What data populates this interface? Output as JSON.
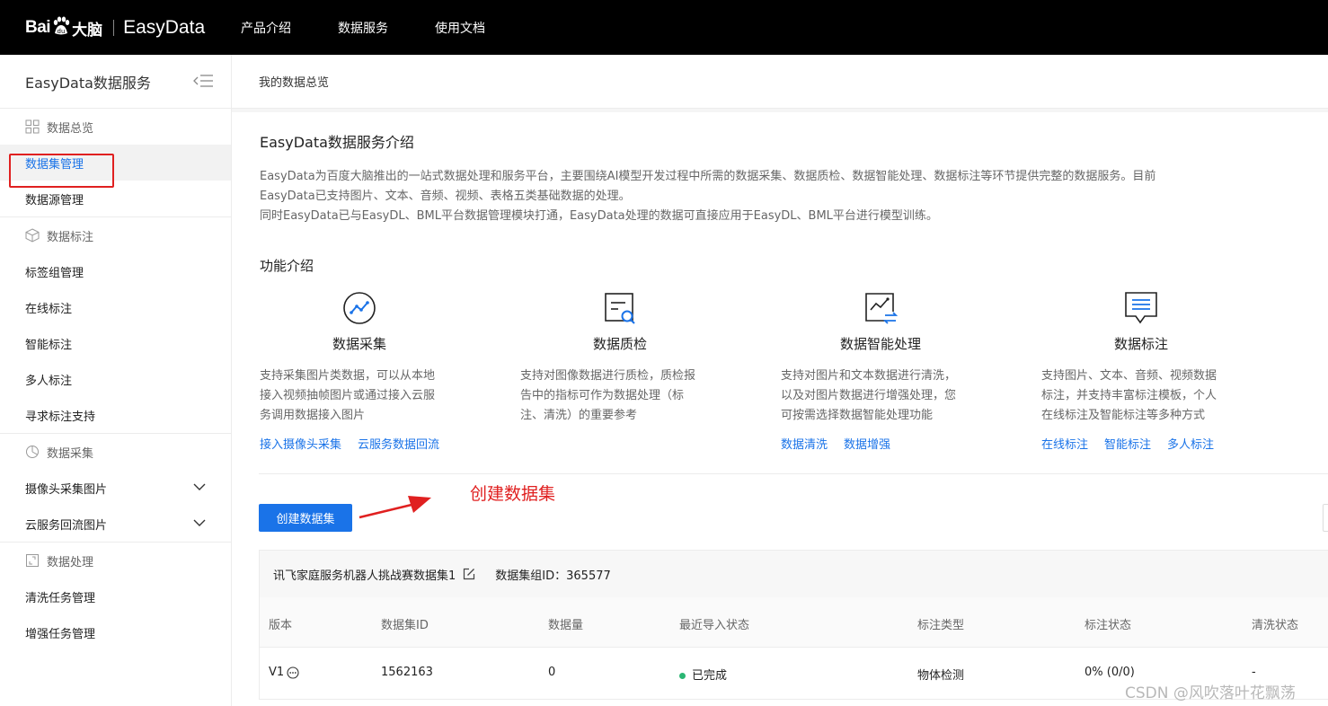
{
  "topbar": {
    "logo_bai": "Bai",
    "logo_danao": "大脑",
    "logo_product": "EasyData",
    "nav": [
      "产品介绍",
      "数据服务",
      "使用文档"
    ]
  },
  "sidebar": {
    "title": "EasyData数据服务",
    "groups": [
      {
        "label": "数据总览",
        "icon": "grid-icon",
        "items": [
          {
            "label": "数据集管理",
            "active": true
          },
          {
            "label": "数据源管理"
          }
        ]
      },
      {
        "label": "数据标注",
        "icon": "cube-icon",
        "items": [
          {
            "label": "标签组管理"
          },
          {
            "label": "在线标注"
          },
          {
            "label": "智能标注"
          },
          {
            "label": "多人标注"
          },
          {
            "label": "寻求标注支持"
          }
        ]
      },
      {
        "label": "数据采集",
        "icon": "pie-icon",
        "items": [
          {
            "label": "摄像头采集图片",
            "expandable": true
          },
          {
            "label": "云服务回流图片",
            "expandable": true
          }
        ]
      },
      {
        "label": "数据处理",
        "icon": "process-icon",
        "items": [
          {
            "label": "清洗任务管理"
          },
          {
            "label": "增强任务管理"
          }
        ]
      }
    ]
  },
  "main": {
    "breadcrumb": "我的数据总览",
    "intro_title": "EasyData数据服务介绍",
    "intro_lines": [
      "EasyData为百度大脑推出的一站式数据处理和服务平台，主要围绕AI模型开发过程中所需的数据采集、数据质检、数据智能处理、数据标注等环节提供完整的数据服务。目前",
      "EasyData已支持图片、文本、音频、视频、表格五类基础数据的处理。",
      "同时EasyData已与EasyDL、BML平台数据管理模块打通，EasyData处理的数据可直接应用于EasyDL、BML平台进行模型训练。"
    ],
    "features_title": "功能介绍",
    "features": [
      {
        "name": "数据采集",
        "icon": "collect-icon",
        "lines": [
          "支持采集图片类数据，可以从本地",
          "接入视频抽帧图片或通过接入云服",
          "务调用数据接入图片"
        ],
        "links": [
          "接入摄像头采集",
          "云服务数据回流"
        ]
      },
      {
        "name": "数据质检",
        "icon": "inspect-icon",
        "lines": [
          "支持对图像数据进行质检，质检报",
          "告中的指标可作为数据处理（标",
          "注、清洗）的重要参考"
        ],
        "links": []
      },
      {
        "name": "数据智能处理",
        "icon": "process-smart-icon",
        "lines": [
          "支持对图片和文本数据进行清洗，",
          "以及对图片数据进行增强处理，您",
          "可按需选择数据智能处理功能"
        ],
        "links": [
          "数据清洗",
          "数据增强"
        ]
      },
      {
        "name": "数据标注",
        "icon": "annotate-icon",
        "lines": [
          "支持图片、文本、音频、视频数据",
          "标注，并支持丰富标注模板，个人",
          "在线标注及智能标注等多种方式"
        ],
        "links": [
          "在线标注",
          "智能标注",
          "多人标注"
        ]
      }
    ],
    "annotation": "创建数据集",
    "create_button": "创建数据集",
    "dataset": {
      "name": "讯飞家庭服务机器人挑战赛数据集1",
      "group_id_label": "数据集组ID：365577",
      "columns": [
        "版本",
        "数据集ID",
        "数据量",
        "最近导入状态",
        "标注类型",
        "标注状态",
        "清洗状态"
      ],
      "rows": [
        {
          "version": "V1",
          "id": "1562163",
          "count": "0",
          "import_status": "已完成",
          "label_type": "物体检测",
          "label_status": "0% (0/0)",
          "clean_status": "-"
        }
      ]
    }
  },
  "watermark": "CSDN @风吹落叶花飘荡",
  "colors": {
    "accent": "#1a73e8",
    "highlight": "#e02020",
    "success": "#2bb673"
  }
}
